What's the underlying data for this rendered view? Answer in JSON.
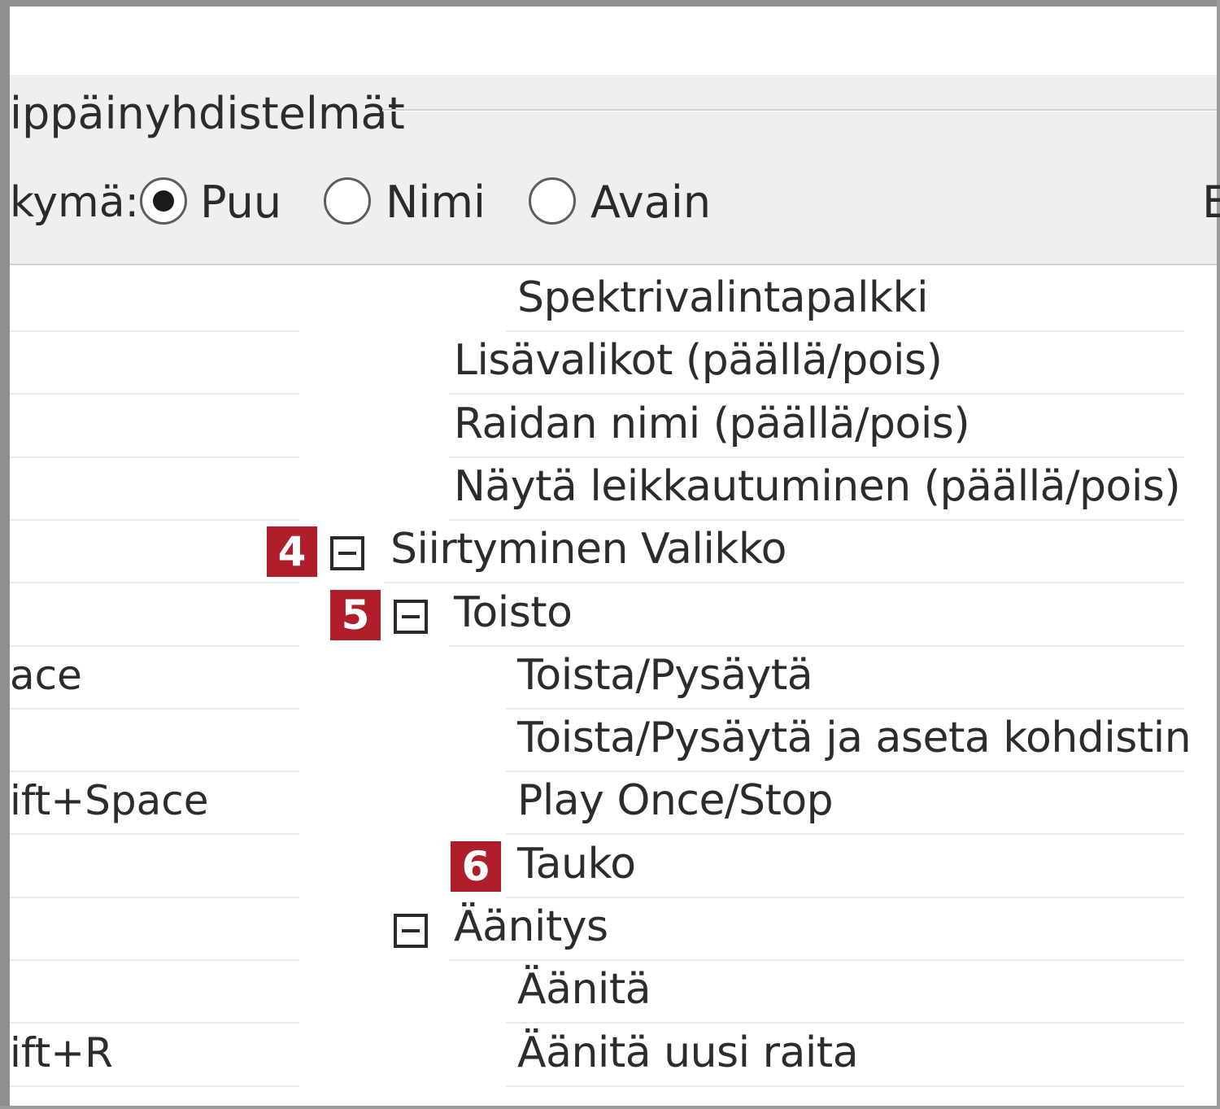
{
  "header": {
    "group_title": "ippäinyhdistelmät",
    "view_label": "kymä:",
    "radios": [
      {
        "label": "Puu",
        "selected": true
      },
      {
        "label": "Nimi",
        "selected": false
      },
      {
        "label": "Avain",
        "selected": false
      }
    ],
    "edge_glyph": "E"
  },
  "tree": [
    {
      "key": "",
      "label": "Spektrivalintapalkki",
      "toggle": false,
      "badge": ""
    },
    {
      "key": "",
      "label": "Lisävalikot (päällä/pois)",
      "toggle": false,
      "badge": ""
    },
    {
      "key": "",
      "label": "Raidan nimi (päällä/pois)",
      "toggle": false,
      "badge": ""
    },
    {
      "key": "",
      "label": "Näytä leikkautuminen (päällä/pois)",
      "toggle": false,
      "badge": ""
    },
    {
      "key": "",
      "label": "Siirtyminen Valikko",
      "toggle": true,
      "badge": "4"
    },
    {
      "key": "",
      "label": "Toisto",
      "toggle": true,
      "badge": "5"
    },
    {
      "key": "ace",
      "label": "Toista/Pysäytä",
      "toggle": false,
      "badge": ""
    },
    {
      "key": "",
      "label": "Toista/Pysäytä ja aseta kohdistin",
      "toggle": false,
      "badge": ""
    },
    {
      "key": "ift+Space",
      "label": "Play Once/Stop",
      "toggle": false,
      "badge": ""
    },
    {
      "key": "",
      "label": "Tauko",
      "toggle": false,
      "badge": "6"
    },
    {
      "key": "",
      "label": "Äänitys",
      "toggle": true,
      "badge": ""
    },
    {
      "key": "",
      "label": "Äänitä",
      "toggle": false,
      "badge": ""
    },
    {
      "key": "ift+R",
      "label": "Äänitä uusi raita",
      "toggle": false,
      "badge": ""
    }
  ]
}
